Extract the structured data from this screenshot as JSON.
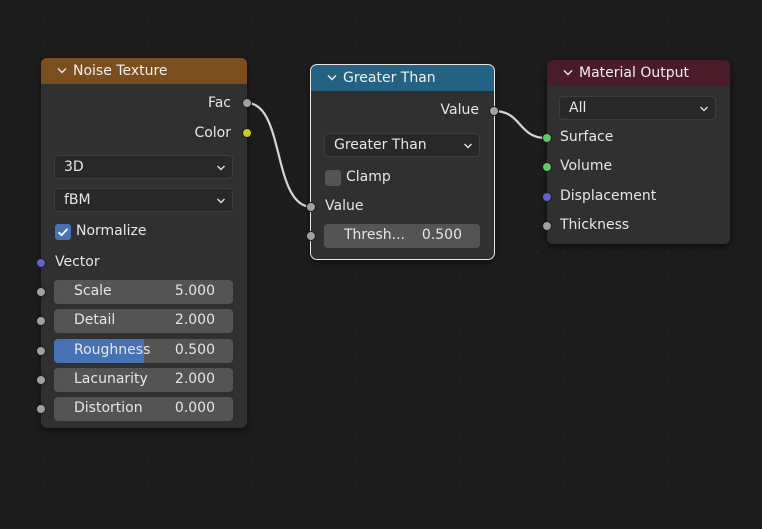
{
  "colors": {
    "canvas_bg": "#1d1d1d",
    "node_body": "#303030",
    "texture_header": "#7b4e1f",
    "converter_header": "#246283",
    "output_header": "#4a1b28",
    "accent": "#4772b3",
    "socket_float": "#a1a1a1",
    "socket_color": "#c7c729",
    "socket_vector": "#6363c7",
    "socket_shader": "#63c763"
  },
  "noise_texture": {
    "title": "Noise Texture",
    "outputs": [
      "Fac",
      "Color"
    ],
    "dimensions": "3D",
    "type": "fBM",
    "normalize_label": "Normalize",
    "normalize_checked": true,
    "vector_label": "Vector",
    "fields": [
      {
        "label": "Scale",
        "value": "5.000"
      },
      {
        "label": "Detail",
        "value": "2.000"
      },
      {
        "label": "Roughness",
        "value": "0.500",
        "fill": 0.5
      },
      {
        "label": "Lacunarity",
        "value": "2.000"
      },
      {
        "label": "Distortion",
        "value": "0.000"
      }
    ]
  },
  "greater_than": {
    "title": "Greater Than",
    "output": "Value",
    "operation": "Greater Than",
    "clamp_label": "Clamp",
    "clamp_checked": false,
    "input_value": "Value",
    "threshold_label": "Thresh...",
    "threshold_value": "0.500"
  },
  "material_output": {
    "title": "Material Output",
    "target": "All",
    "inputs": [
      "Surface",
      "Volume",
      "Displacement",
      "Thickness"
    ]
  }
}
